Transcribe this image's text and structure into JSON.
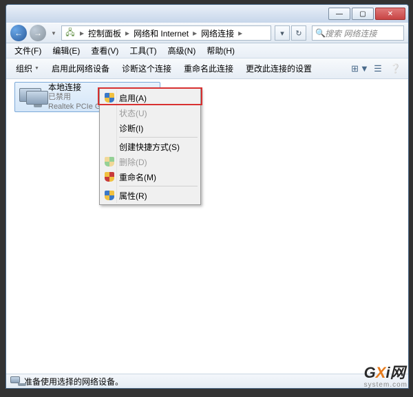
{
  "titlebar": {
    "min": "—",
    "max": "▢",
    "close": "✕"
  },
  "nav": {
    "back": "←",
    "fwd": "→",
    "drop": "▼"
  },
  "address": {
    "icon": "🖧",
    "seg1": "控制面板",
    "seg2": "网络和 Internet",
    "seg3": "网络连接",
    "chev": "▸",
    "refresh": "↻",
    "dropdown": "▾"
  },
  "search": {
    "placeholder": "搜索 网络连接",
    "icon": "🔍"
  },
  "menu": {
    "file": "文件(F)",
    "edit": "编辑(E)",
    "view": "查看(V)",
    "tools": "工具(T)",
    "advanced": "高级(N)",
    "help": "帮助(H)"
  },
  "cmd": {
    "organize": "组织",
    "enable": "启用此网络设备",
    "diagnose": "诊断这个连接",
    "rename": "重命名此连接",
    "change": "更改此连接的设置",
    "view_icon": "⊞",
    "list_icon": "☰",
    "help_icon": "❔"
  },
  "item": {
    "name": "本地连接",
    "status": "已禁用",
    "device": "Realtek PCIe G..."
  },
  "ctx": {
    "enable": "启用(A)",
    "status": "状态(U)",
    "diagnose": "诊断(I)",
    "shortcut": "创建快捷方式(S)",
    "delete": "删除(D)",
    "rename": "重命名(M)",
    "properties": "属性(R)"
  },
  "statusbar": {
    "text": "准备使用选择的网络设备。"
  },
  "watermark": {
    "brand_g": "G",
    "brand_x": "X",
    "brand_i": "i",
    "brand_net": "网",
    "sub": "system.com"
  }
}
